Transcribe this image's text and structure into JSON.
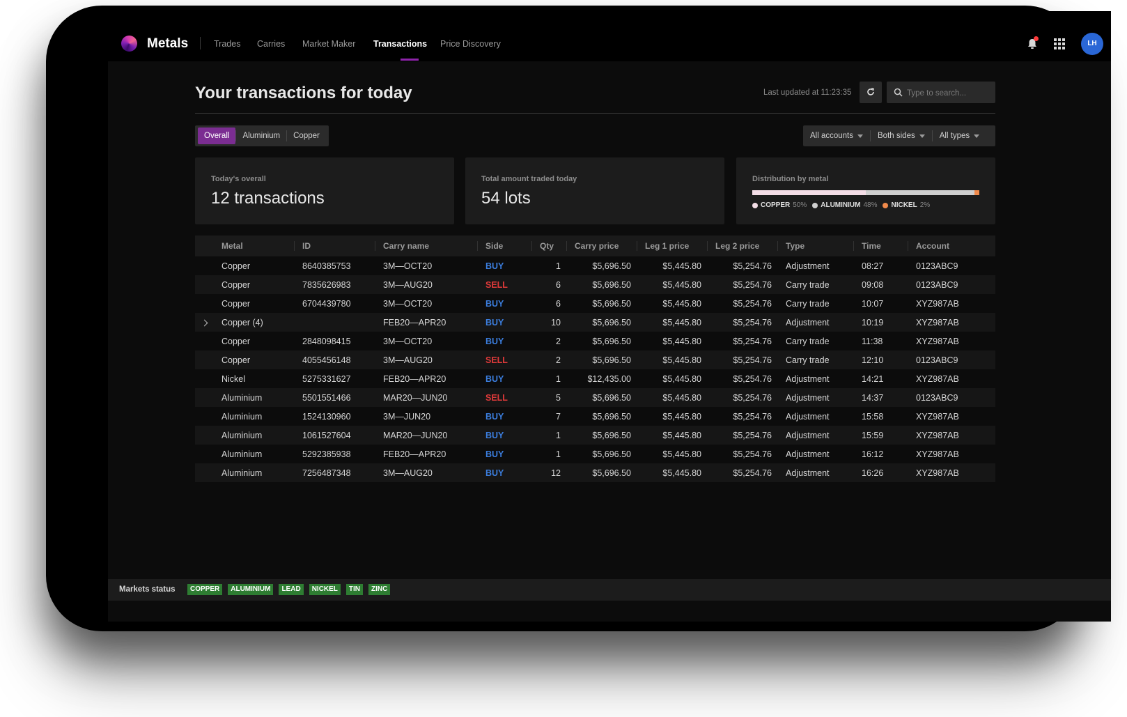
{
  "app": {
    "brand": "Metals"
  },
  "nav": {
    "items": [
      {
        "label": "Trades"
      },
      {
        "label": "Carries"
      },
      {
        "label": "Market Maker"
      },
      {
        "label": "Transactions"
      },
      {
        "label": "Price Discovery"
      }
    ],
    "active": "Transactions"
  },
  "user": {
    "initials": "LH"
  },
  "colors": {
    "accent": "#7b2d92",
    "buy": "#3b7ddd",
    "sell": "#e03a3a",
    "market_open": "#2e7d32"
  },
  "header": {
    "title": "Your transactions for today",
    "last_updated": "Last updated at 11:23:35",
    "search_placeholder": "Type to search..."
  },
  "metal_tabs": [
    {
      "label": "Overall",
      "active": true
    },
    {
      "label": "Aluminium",
      "active": false
    },
    {
      "label": "Copper",
      "active": false
    }
  ],
  "filters": [
    {
      "label": "All accounts"
    },
    {
      "label": "Both sides"
    },
    {
      "label": "All types"
    }
  ],
  "cards": {
    "overall": {
      "label": "Today's overall",
      "value": "12 transactions"
    },
    "amount": {
      "label": "Total amount traded today",
      "value": "54 lots"
    },
    "distribution": {
      "label": "Distribution by metal",
      "items": [
        {
          "name": "COPPER",
          "pct": "50%",
          "share": 50,
          "color": "#f3dde6"
        },
        {
          "name": "ALUMINIUM",
          "pct": "48%",
          "share": 48,
          "color": "#cfcfcf"
        },
        {
          "name": "NICKEL",
          "pct": "2%",
          "share": 2,
          "color": "#f08a4b"
        }
      ]
    }
  },
  "table": {
    "columns": [
      "Metal",
      "ID",
      "Carry name",
      "Side",
      "Qty",
      "Carry price",
      "Leg 1 price",
      "Leg 2 price",
      "Type",
      "Time",
      "Account"
    ],
    "rows": [
      {
        "metal": "Copper",
        "id": "8640385753",
        "carry": "3M—OCT20",
        "side": "BUY",
        "qty": "1",
        "carry_price": "$5,696.50",
        "leg1": "$5,445.80",
        "leg2": "$5,254.76",
        "type": "Adjustment",
        "time": "08:27",
        "account": "0123ABC9"
      },
      {
        "metal": "Copper",
        "id": "7835626983",
        "carry": "3M—AUG20",
        "side": "SELL",
        "qty": "6",
        "carry_price": "$5,696.50",
        "leg1": "$5,445.80",
        "leg2": "$5,254.76",
        "type": "Carry trade",
        "time": "09:08",
        "account": "0123ABC9"
      },
      {
        "metal": "Copper",
        "id": "6704439780",
        "carry": "3M—OCT20",
        "side": "BUY",
        "qty": "6",
        "carry_price": "$5,696.50",
        "leg1": "$5,445.80",
        "leg2": "$5,254.76",
        "type": "Carry trade",
        "time": "10:07",
        "account": "XYZ987AB"
      },
      {
        "metal": "Copper (4)",
        "id": "",
        "carry": "FEB20—APR20",
        "side": "BUY",
        "qty": "10",
        "carry_price": "$5,696.50",
        "leg1": "$5,445.80",
        "leg2": "$5,254.76",
        "type": "Adjustment",
        "time": "10:19",
        "account": "XYZ987AB",
        "expandable": true
      },
      {
        "metal": "Copper",
        "id": "2848098415",
        "carry": "3M—OCT20",
        "side": "BUY",
        "qty": "2",
        "carry_price": "$5,696.50",
        "leg1": "$5,445.80",
        "leg2": "$5,254.76",
        "type": "Carry trade",
        "time": "11:38",
        "account": "XYZ987AB"
      },
      {
        "metal": "Copper",
        "id": "4055456148",
        "carry": "3M—AUG20",
        "side": "SELL",
        "qty": "2",
        "carry_price": "$5,696.50",
        "leg1": "$5,445.80",
        "leg2": "$5,254.76",
        "type": "Carry trade",
        "time": "12:10",
        "account": "0123ABC9"
      },
      {
        "metal": "Nickel",
        "id": "5275331627",
        "carry": "FEB20—APR20",
        "side": "BUY",
        "qty": "1",
        "carry_price": "$12,435.00",
        "leg1": "$5,445.80",
        "leg2": "$5,254.76",
        "type": "Adjustment",
        "time": "14:21",
        "account": "XYZ987AB"
      },
      {
        "metal": "Aluminium",
        "id": "5501551466",
        "carry": "MAR20—JUN20",
        "side": "SELL",
        "qty": "5",
        "carry_price": "$5,696.50",
        "leg1": "$5,445.80",
        "leg2": "$5,254.76",
        "type": "Adjustment",
        "time": "14:37",
        "account": "0123ABC9"
      },
      {
        "metal": "Aluminium",
        "id": "1524130960",
        "carry": "3M—JUN20",
        "side": "BUY",
        "qty": "7",
        "carry_price": "$5,696.50",
        "leg1": "$5,445.80",
        "leg2": "$5,254.76",
        "type": "Adjustment",
        "time": "15:58",
        "account": "XYZ987AB"
      },
      {
        "metal": "Aluminium",
        "id": "1061527604",
        "carry": "MAR20—JUN20",
        "side": "BUY",
        "qty": "1",
        "carry_price": "$5,696.50",
        "leg1": "$5,445.80",
        "leg2": "$5,254.76",
        "type": "Adjustment",
        "time": "15:59",
        "account": "XYZ987AB"
      },
      {
        "metal": "Aluminium",
        "id": "5292385938",
        "carry": "FEB20—APR20",
        "side": "BUY",
        "qty": "1",
        "carry_price": "$5,696.50",
        "leg1": "$5,445.80",
        "leg2": "$5,254.76",
        "type": "Adjustment",
        "time": "16:12",
        "account": "XYZ987AB"
      },
      {
        "metal": "Aluminium",
        "id": "7256487348",
        "carry": "3M—AUG20",
        "side": "BUY",
        "qty": "12",
        "carry_price": "$5,696.50",
        "leg1": "$5,445.80",
        "leg2": "$5,254.76",
        "type": "Adjustment",
        "time": "16:26",
        "account": "XYZ987AB"
      }
    ]
  },
  "footer": {
    "label": "Markets status",
    "markets": [
      "COPPER",
      "ALUMINIUM",
      "LEAD",
      "NICKEL",
      "TIN",
      "ZINC"
    ]
  }
}
